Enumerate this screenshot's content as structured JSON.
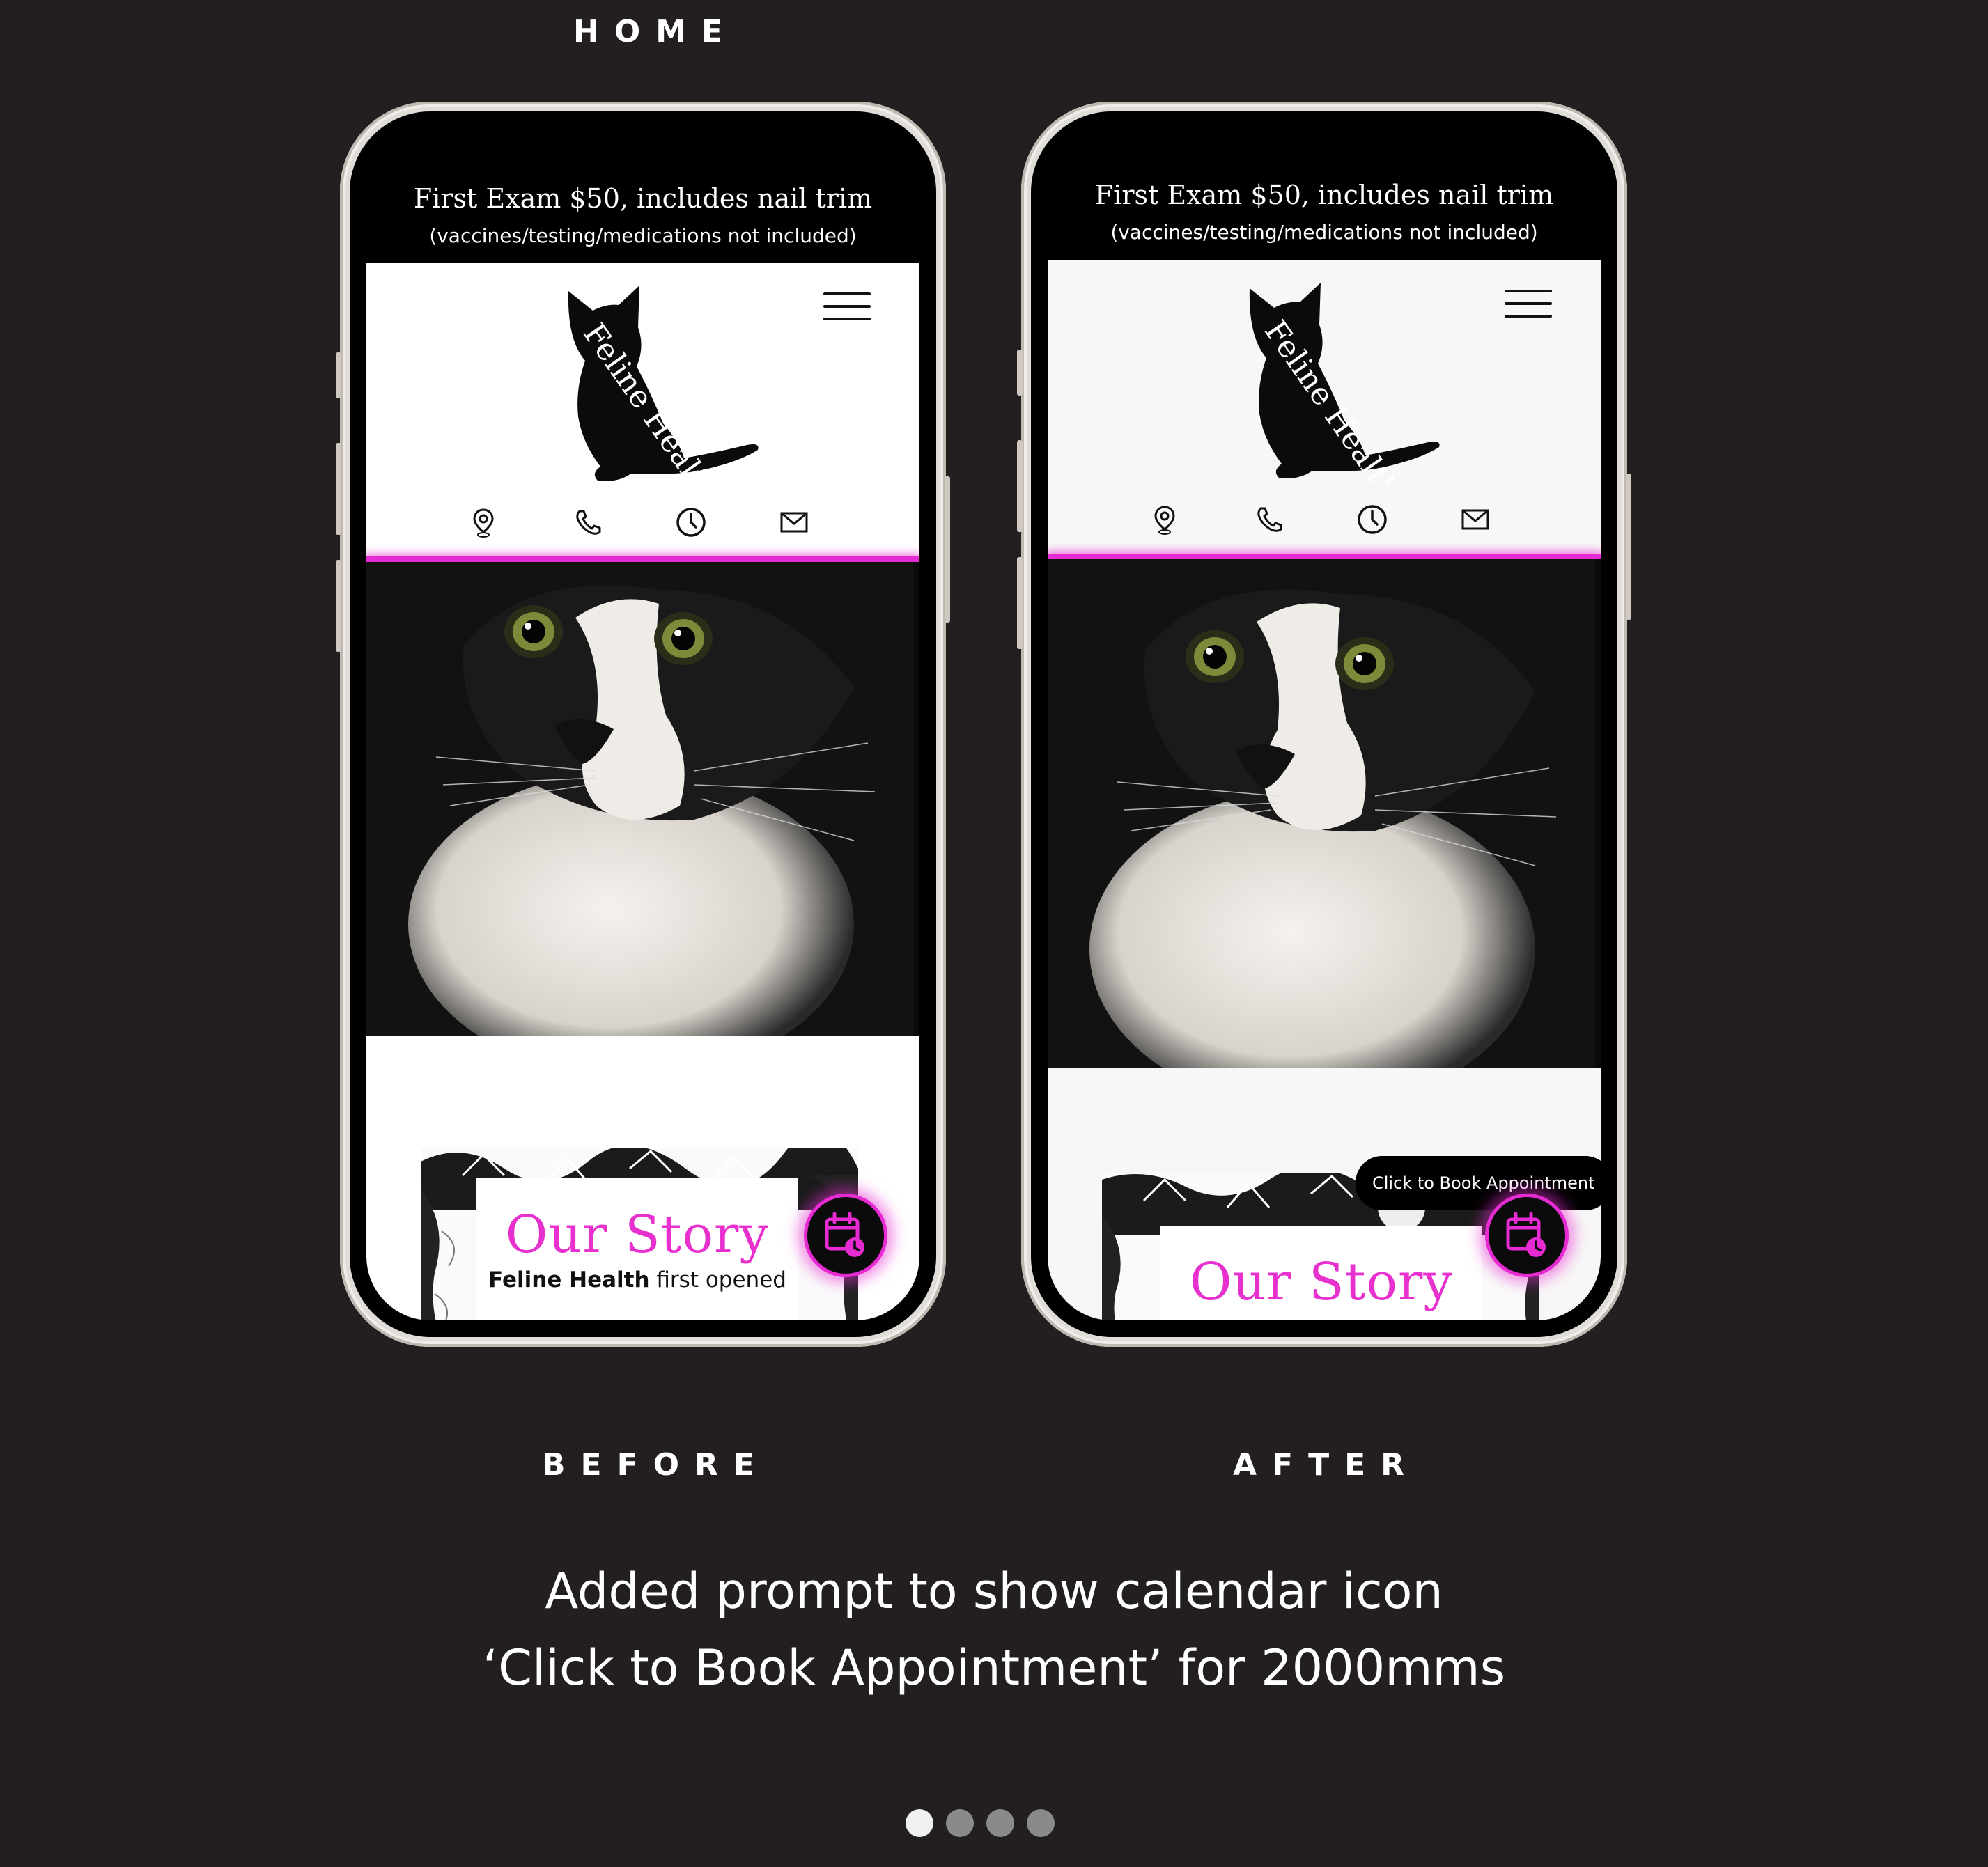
{
  "page": {
    "title": "HOME",
    "before_label": "BEFORE",
    "after_label": "AFTER",
    "caption_line1": "Added prompt to show calendar icon",
    "caption_line2": "‘Click to Book Appointment’ for 2000mms",
    "pagination": {
      "total": 4,
      "active_index": 0
    }
  },
  "site": {
    "promo_line1": "First Exam $50, includes nail trim",
    "promo_line2": "(vaccines/testing/medications not included)",
    "logo_text": "Feline Health",
    "contact_icons": [
      "location-pin-icon",
      "phone-icon",
      "clock-icon",
      "mail-icon"
    ],
    "story_title": "Our Story",
    "story_text_bold": "Feline Health",
    "story_text_rest": " first opened",
    "tooltip": "Click to Book Appointment",
    "accent_color": "#e52bd1"
  }
}
